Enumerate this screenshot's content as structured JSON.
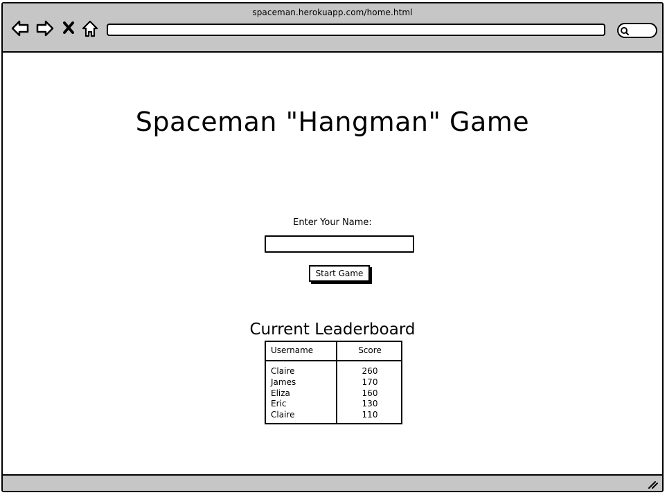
{
  "browser": {
    "url": "spaceman.herokuapp.com/home.html",
    "address_value": "",
    "icons": {
      "back": "back-arrow-icon",
      "forward": "forward-arrow-icon",
      "stop": "close-icon",
      "home": "home-icon",
      "search": "search-icon",
      "resize": "resize-grip-icon"
    }
  },
  "page": {
    "title": "Spaceman \"Hangman\" Game",
    "name_label": "Enter Your Name:",
    "name_value": "",
    "start_button_label": "Start Game"
  },
  "leaderboard": {
    "title": "Current Leaderboard",
    "columns": [
      "Username",
      "Score"
    ],
    "rows": [
      {
        "username": "Claire",
        "score": "260"
      },
      {
        "username": "James",
        "score": "170"
      },
      {
        "username": "Eliza",
        "score": "160"
      },
      {
        "username": "Eric",
        "score": "130"
      },
      {
        "username": "Claire",
        "score": "110"
      }
    ]
  },
  "colors": {
    "chrome_gray": "#c6c6c6",
    "ink": "#000000",
    "page": "#ffffff"
  }
}
